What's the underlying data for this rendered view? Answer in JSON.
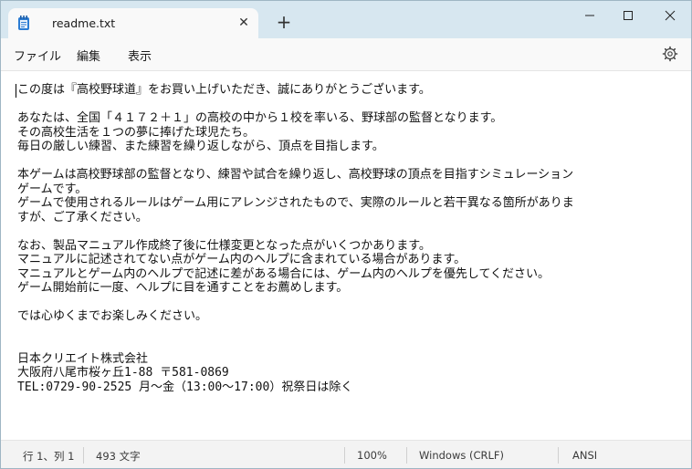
{
  "tab": {
    "title": "readme.txt",
    "close": "✕",
    "new_tab": "+"
  },
  "menu": {
    "file": "ファイル",
    "edit": "編集",
    "view": "表示"
  },
  "document": {
    "lines": [
      "この度は『高校野球道』をお買い上げいただき、誠にありがとうございます。",
      "",
      "あなたは、全国「４１７２＋１」の高校の中から１校を率いる、野球部の監督となります。",
      "その高校生活を１つの夢に捧げた球児たち。",
      "毎日の厳しい練習、また練習を繰り返しながら、頂点を目指します。",
      "",
      "本ゲームは高校野球部の監督となり、練習や試合を繰り返し、高校野球の頂点を目指すシミュレーション",
      "ゲームです。",
      "ゲームで使用されるルールはゲーム用にアレンジされたもので、実際のルールと若干異なる箇所がありま",
      "すが、ご了承ください。",
      "",
      "なお、製品マニュアル作成終了後に仕様変更となった点がいくつかあります。",
      "マニュアルに記述されてない点がゲーム内のヘルプに含まれている場合があります。",
      "マニュアルとゲーム内のヘルプで記述に差がある場合には、ゲーム内のヘルプを優先してください。",
      "ゲーム開始前に一度、ヘルプに目を通すことをお薦めします。",
      "",
      "では心ゆくまでお楽しみください。",
      "",
      "",
      "日本クリエイト株式会社",
      "大阪府八尾市桜ヶ丘1-88 〒581-0869",
      "TEL:0729-90-2525 月～金（13:00～17:00）祝祭日は除く"
    ]
  },
  "status": {
    "position": "行 1、列 1",
    "chars": "493 文字",
    "zoom": "100%",
    "line_ending": "Windows (CRLF)",
    "encoding": "ANSI"
  }
}
